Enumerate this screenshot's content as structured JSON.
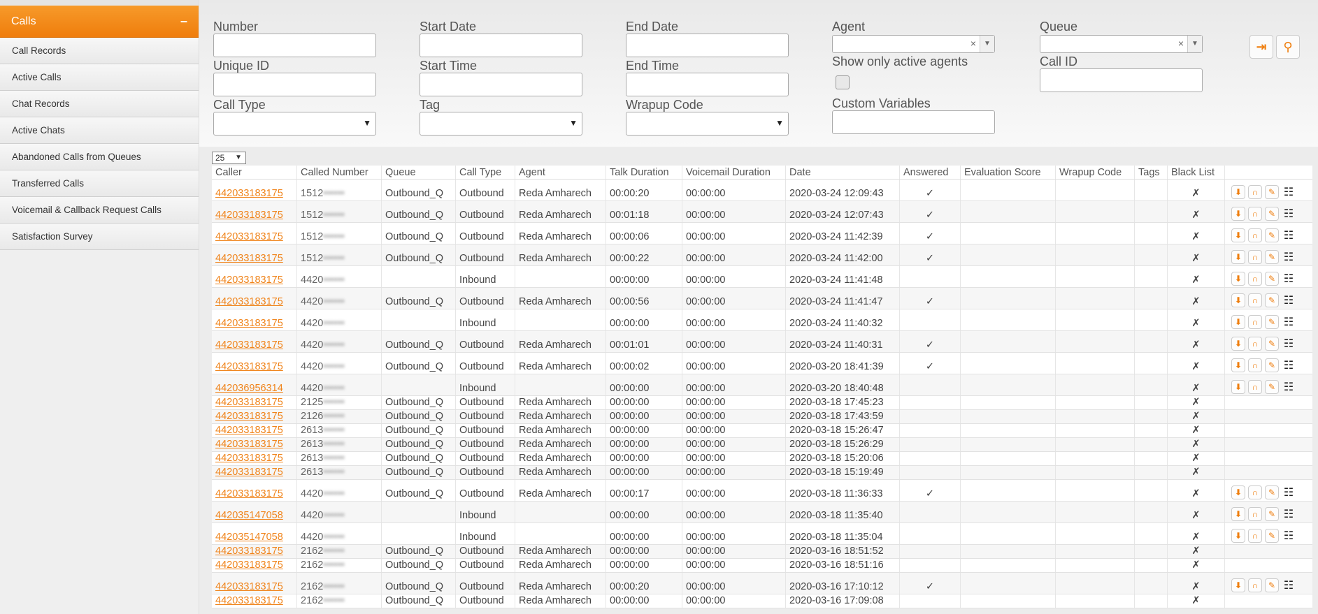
{
  "sidebar": {
    "header": {
      "label": "Calls",
      "toggle": "–"
    },
    "items": [
      {
        "label": "Call Records"
      },
      {
        "label": "Active Calls"
      },
      {
        "label": "Chat Records"
      },
      {
        "label": "Active Chats"
      },
      {
        "label": "Abandoned Calls from Queues"
      },
      {
        "label": "Transferred Calls"
      },
      {
        "label": "Voicemail & Callback Request Calls"
      },
      {
        "label": "Satisfaction Survey"
      }
    ]
  },
  "filters": {
    "number": {
      "label": "Number",
      "value": ""
    },
    "start_date": {
      "label": "Start Date",
      "value": ""
    },
    "end_date": {
      "label": "End Date",
      "value": ""
    },
    "agent": {
      "label": "Agent",
      "value": ""
    },
    "queue": {
      "label": "Queue",
      "value": ""
    },
    "unique_id": {
      "label": "Unique ID",
      "value": ""
    },
    "start_time": {
      "label": "Start Time",
      "value": ""
    },
    "end_time": {
      "label": "End Time",
      "value": ""
    },
    "show_active": {
      "label": "Show only active agents",
      "checked": false
    },
    "call_id": {
      "label": "Call ID",
      "value": ""
    },
    "call_type": {
      "label": "Call Type",
      "value": ""
    },
    "tag": {
      "label": "Tag",
      "value": ""
    },
    "wrapup_code": {
      "label": "Wrapup Code",
      "value": ""
    },
    "custom_variables": {
      "label": "Custom Variables",
      "value": ""
    },
    "export_icon": "export-icon",
    "search_icon": "search-icon"
  },
  "table": {
    "page_size": "25",
    "columns": [
      "Caller",
      "Called Number",
      "Queue",
      "Call Type",
      "Agent",
      "Talk Duration",
      "Voicemail Duration",
      "Date",
      "Answered",
      "Evaluation Score",
      "Wrapup Code",
      "Tags",
      "Black List"
    ],
    "rows": [
      {
        "caller": "442033183175",
        "called": "1512",
        "queue": "Outbound_Q",
        "type": "Outbound",
        "agent": "Reda Amharech",
        "talk": "00:00:20",
        "vm": "00:00:00",
        "date": "2020-03-24 12:09:43",
        "answered": "✓",
        "black": "✗",
        "buttons": true
      },
      {
        "caller": "442033183175",
        "called": "1512",
        "queue": "Outbound_Q",
        "type": "Outbound",
        "agent": "Reda Amharech",
        "talk": "00:01:18",
        "vm": "00:00:00",
        "date": "2020-03-24 12:07:43",
        "answered": "✓",
        "black": "✗",
        "buttons": true
      },
      {
        "caller": "442033183175",
        "called": "1512",
        "queue": "Outbound_Q",
        "type": "Outbound",
        "agent": "Reda Amharech",
        "talk": "00:00:06",
        "vm": "00:00:00",
        "date": "2020-03-24 11:42:39",
        "answered": "✓",
        "black": "✗",
        "buttons": true
      },
      {
        "caller": "442033183175",
        "called": "1512",
        "queue": "Outbound_Q",
        "type": "Outbound",
        "agent": "Reda Amharech",
        "talk": "00:00:22",
        "vm": "00:00:00",
        "date": "2020-03-24 11:42:00",
        "answered": "✓",
        "black": "✗",
        "buttons": true
      },
      {
        "caller": "442033183175",
        "called": "4420",
        "queue": "",
        "type": "Inbound",
        "agent": "",
        "talk": "00:00:00",
        "vm": "00:00:00",
        "date": "2020-03-24 11:41:48",
        "answered": "",
        "black": "✗",
        "buttons": true
      },
      {
        "caller": "442033183175",
        "called": "4420",
        "queue": "Outbound_Q",
        "type": "Outbound",
        "agent": "Reda Amharech",
        "talk": "00:00:56",
        "vm": "00:00:00",
        "date": "2020-03-24 11:41:47",
        "answered": "✓",
        "black": "✗",
        "buttons": true
      },
      {
        "caller": "442033183175",
        "called": "4420",
        "queue": "",
        "type": "Inbound",
        "agent": "",
        "talk": "00:00:00",
        "vm": "00:00:00",
        "date": "2020-03-24 11:40:32",
        "answered": "",
        "black": "✗",
        "buttons": true
      },
      {
        "caller": "442033183175",
        "called": "4420",
        "queue": "Outbound_Q",
        "type": "Outbound",
        "agent": "Reda Amharech",
        "talk": "00:01:01",
        "vm": "00:00:00",
        "date": "2020-03-24 11:40:31",
        "answered": "✓",
        "black": "✗",
        "buttons": true
      },
      {
        "caller": "442033183175",
        "called": "4420",
        "queue": "Outbound_Q",
        "type": "Outbound",
        "agent": "Reda Amharech",
        "talk": "00:00:02",
        "vm": "00:00:00",
        "date": "2020-03-20 18:41:39",
        "answered": "✓",
        "black": "✗",
        "buttons": true
      },
      {
        "caller": "442036956314",
        "called": "4420",
        "queue": "",
        "type": "Inbound",
        "agent": "",
        "talk": "00:00:00",
        "vm": "00:00:00",
        "date": "2020-03-20 18:40:48",
        "answered": "",
        "black": "✗",
        "buttons": true
      },
      {
        "caller": "442033183175",
        "called": "2125",
        "queue": "Outbound_Q",
        "type": "Outbound",
        "agent": "Reda Amharech",
        "talk": "00:00:00",
        "vm": "00:00:00",
        "date": "2020-03-18 17:45:23",
        "answered": "",
        "black": "✗",
        "buttons": false
      },
      {
        "caller": "442033183175",
        "called": "2126",
        "queue": "Outbound_Q",
        "type": "Outbound",
        "agent": "Reda Amharech",
        "talk": "00:00:00",
        "vm": "00:00:00",
        "date": "2020-03-18 17:43:59",
        "answered": "",
        "black": "✗",
        "buttons": false
      },
      {
        "caller": "442033183175",
        "called": "2613",
        "queue": "Outbound_Q",
        "type": "Outbound",
        "agent": "Reda Amharech",
        "talk": "00:00:00",
        "vm": "00:00:00",
        "date": "2020-03-18 15:26:47",
        "answered": "",
        "black": "✗",
        "buttons": false
      },
      {
        "caller": "442033183175",
        "called": "2613",
        "queue": "Outbound_Q",
        "type": "Outbound",
        "agent": "Reda Amharech",
        "talk": "00:00:00",
        "vm": "00:00:00",
        "date": "2020-03-18 15:26:29",
        "answered": "",
        "black": "✗",
        "buttons": false
      },
      {
        "caller": "442033183175",
        "called": "2613",
        "queue": "Outbound_Q",
        "type": "Outbound",
        "agent": "Reda Amharech",
        "talk": "00:00:00",
        "vm": "00:00:00",
        "date": "2020-03-18 15:20:06",
        "answered": "",
        "black": "✗",
        "buttons": false
      },
      {
        "caller": "442033183175",
        "called": "2613",
        "queue": "Outbound_Q",
        "type": "Outbound",
        "agent": "Reda Amharech",
        "talk": "00:00:00",
        "vm": "00:00:00",
        "date": "2020-03-18 15:19:49",
        "answered": "",
        "black": "✗",
        "buttons": false
      },
      {
        "caller": "442033183175",
        "called": "4420",
        "queue": "Outbound_Q",
        "type": "Outbound",
        "agent": "Reda Amharech",
        "talk": "00:00:17",
        "vm": "00:00:00",
        "date": "2020-03-18 11:36:33",
        "answered": "✓",
        "black": "✗",
        "buttons": true
      },
      {
        "caller": "442035147058",
        "called": "4420",
        "queue": "",
        "type": "Inbound",
        "agent": "",
        "talk": "00:00:00",
        "vm": "00:00:00",
        "date": "2020-03-18 11:35:40",
        "answered": "",
        "black": "✗",
        "buttons": true
      },
      {
        "caller": "442035147058",
        "called": "4420",
        "queue": "",
        "type": "Inbound",
        "agent": "",
        "talk": "00:00:00",
        "vm": "00:00:00",
        "date": "2020-03-18 11:35:04",
        "answered": "",
        "black": "✗",
        "buttons": true
      },
      {
        "caller": "442033183175",
        "called": "2162",
        "queue": "Outbound_Q",
        "type": "Outbound",
        "agent": "Reda Amharech",
        "talk": "00:00:00",
        "vm": "00:00:00",
        "date": "2020-03-16 18:51:52",
        "answered": "",
        "black": "✗",
        "buttons": false
      },
      {
        "caller": "442033183175",
        "called": "2162",
        "queue": "Outbound_Q",
        "type": "Outbound",
        "agent": "Reda Amharech",
        "talk": "00:00:00",
        "vm": "00:00:00",
        "date": "2020-03-16 18:51:16",
        "answered": "",
        "black": "✗",
        "buttons": false
      },
      {
        "caller": "442033183175",
        "called": "2162",
        "queue": "Outbound_Q",
        "type": "Outbound",
        "agent": "Reda Amharech",
        "talk": "00:00:20",
        "vm": "00:00:00",
        "date": "2020-03-16 17:10:12",
        "answered": "✓",
        "black": "✗",
        "buttons": true
      },
      {
        "caller": "442033183175",
        "called": "2162",
        "queue": "Outbound_Q",
        "type": "Outbound",
        "agent": "Reda Amharech",
        "talk": "00:00:00",
        "vm": "00:00:00",
        "date": "2020-03-16 17:09:08",
        "answered": "",
        "black": "✗",
        "buttons": false
      }
    ],
    "row_buttons": {
      "download_icon": "download-icon",
      "listen_icon": "headphones-icon",
      "edit_icon": "pencil-icon",
      "notes_icon": "clipboard-icon"
    }
  },
  "colors": {
    "accent": "#ef7d0c",
    "link": "#f0841b"
  }
}
